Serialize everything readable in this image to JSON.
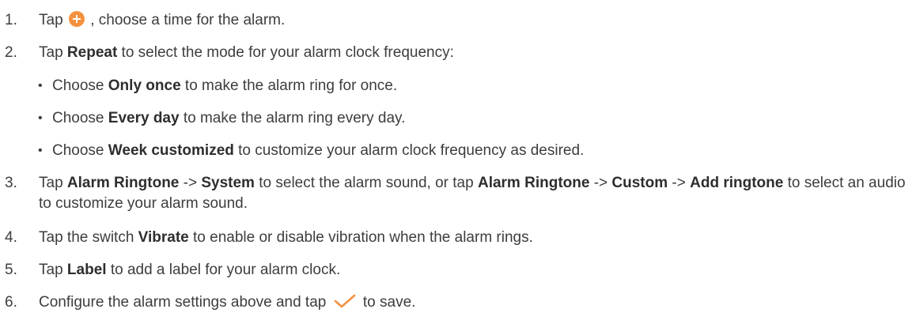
{
  "steps": [
    {
      "num": "1.",
      "before": "Tap",
      "icon": "plus-icon",
      "after": ", choose a time for the alarm."
    },
    {
      "num": "2.",
      "t1": "Tap ",
      "b1": "Repeat",
      "t2": " to select the mode for your alarm clock frequency:",
      "subs": [
        {
          "bullet": "•",
          "t1": "Choose ",
          "b1": "Only once",
          "t2": " to make the alarm ring for once."
        },
        {
          "bullet": "•",
          "t1": "Choose ",
          "b1": "Every day",
          "t2": " to make the alarm ring every day."
        },
        {
          "bullet": "•",
          "t1": "Choose ",
          "b1": "Week customized",
          "t2": " to customize your alarm clock frequency as desired."
        }
      ]
    },
    {
      "num": "3.",
      "t1": "Tap ",
      "b1": "Alarm Ringtone",
      "t2": " -> ",
      "b2": "System",
      "t3": " to select the alarm sound, or tap ",
      "b3": "Alarm Ringtone",
      "t4": " -> ",
      "b4": "Custom",
      "t5": " -> ",
      "b5": "Add ringtone",
      "t6": " to select an audio to customize your alarm sound."
    },
    {
      "num": "4.",
      "t1": "Tap the switch ",
      "b1": "Vibrate",
      "t2": " to enable or disable vibration when the alarm rings."
    },
    {
      "num": "5.",
      "t1": "Tap ",
      "b1": "Label",
      "t2": " to add a label for your alarm clock."
    },
    {
      "num": "6.",
      "before": "Configure the alarm settings above and tap",
      "icon": "check-icon",
      "after": "to save."
    }
  ],
  "colors": {
    "accent": "#f5913f",
    "text": "#3d3d3d"
  }
}
